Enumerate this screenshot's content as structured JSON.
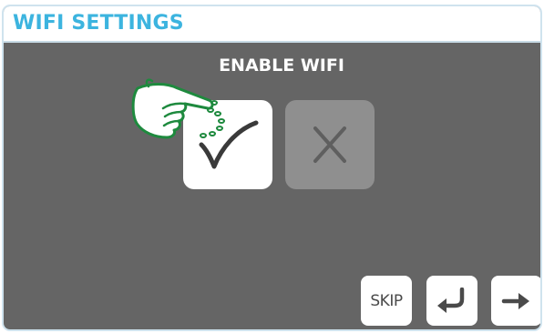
{
  "window": {
    "title": "WIFI SETTINGS"
  },
  "wifi_prompt": {
    "label": "ENABLE WIFI",
    "confirm_icon": "checkmark-icon",
    "cancel_icon": "x-icon",
    "hint_icon": "pointing-hand-icon"
  },
  "navigation": {
    "skip_label": "SKIP",
    "back_icon": "return-arrow-icon",
    "next_icon": "right-arrow-icon"
  },
  "colors": {
    "title_text": "#3cb4df",
    "panel_background": "#656565",
    "enabled_button": "#ffffff",
    "disabled_button": "#8f8f8f",
    "hint_hand": "#1e8a3e"
  }
}
